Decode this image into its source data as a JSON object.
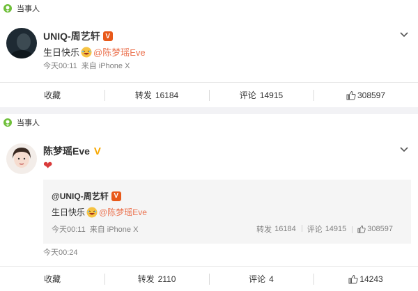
{
  "post1": {
    "tag_label": "当事人",
    "author": "UNIQ-周艺轩",
    "badge": "V",
    "text": "生日快乐",
    "mention": "@陈梦瑶Eve",
    "time": "今天00:11",
    "source": "来自 iPhone X",
    "actions": {
      "collect_label": "收藏",
      "repost_label": "转发",
      "repost_count": "16184",
      "comment_label": "评论",
      "comment_count": "14915",
      "like_count": "308597"
    }
  },
  "post2": {
    "tag_label": "当事人",
    "author": "陈梦瑶Eve",
    "badge": "V",
    "text": "❤",
    "repost": {
      "author": "@UNIQ-周艺轩",
      "badge": "V",
      "text": "生日快乐",
      "mention": "@陈梦瑶Eve",
      "time": "今天00:11",
      "source": "来自 iPhone X",
      "repost_label": "转发",
      "repost_count": "16184",
      "comment_label": "评论",
      "comment_count": "14915",
      "like_count": "308597"
    },
    "time": "今天00:24",
    "actions": {
      "collect_label": "收藏",
      "repost_label": "转发",
      "repost_count": "2110",
      "comment_label": "评论",
      "comment_count": "4",
      "like_count": "14243"
    }
  },
  "colors": {
    "mention": "#eb7350",
    "gold_v": "#f7a700",
    "red_v": "#e8591a",
    "tag_green": "#6fbf3a"
  }
}
